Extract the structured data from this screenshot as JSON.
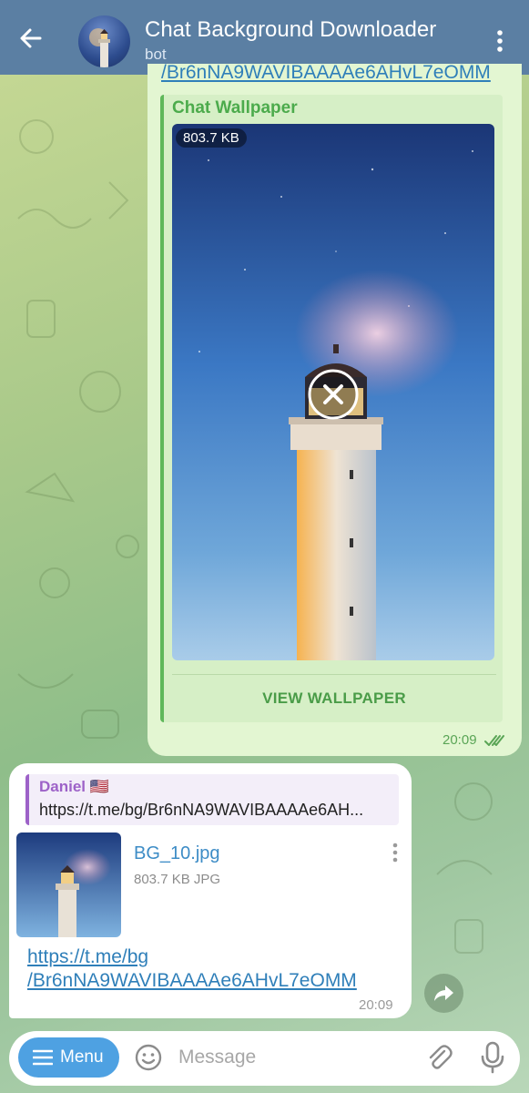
{
  "header": {
    "title": "Chat Background Downloader",
    "subtitle": "bot"
  },
  "outgoing": {
    "top_link": "/Br6nNA9WAVIBAAAAe6AHvL7eOMM",
    "card_title": "Chat Wallpaper",
    "file_size": "803.7 KB",
    "action_label": "VIEW WALLPAPER",
    "time": "20:09"
  },
  "incoming": {
    "reply_name": "Daniel 🇺🇸",
    "reply_text": "https://t.me/bg/Br6nNA9WAVIBAAAAe6AH...",
    "file_name": "BG_10.jpg",
    "file_meta": "803.7 KB JPG",
    "link_line1": "https://t.me/bg",
    "link_line2": "/Br6nNA9WAVIBAAAAe6AHvL7eOMM",
    "time": "20:09"
  },
  "input_bar": {
    "menu_label": "Menu",
    "placeholder": "Message"
  },
  "colors": {
    "header": "#5b7fa3",
    "outgoing_bubble": "#e3f6d2",
    "accent_green": "#4cab4c",
    "link_blue": "#2f7fb9",
    "menu_button": "#4ea1e2"
  },
  "icons": [
    "back-arrow-icon",
    "kebab-menu-icon",
    "cancel-download-icon",
    "double-check-icon",
    "file-menu-icon",
    "share-icon",
    "hamburger-icon",
    "emoji-icon",
    "attach-icon",
    "mic-icon"
  ]
}
